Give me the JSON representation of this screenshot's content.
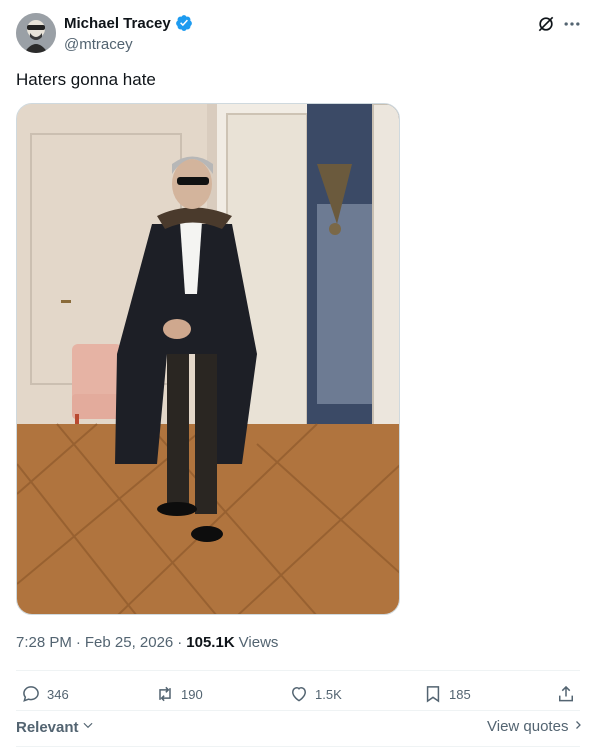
{
  "author": {
    "display_name": "Michael Tracey",
    "handle": "@mtracey",
    "verified_icon": "verified-badge-icon",
    "avatar_icon": "avatar-image"
  },
  "header_actions": {
    "grok_icon": "grok-icon",
    "more_icon": "more-options-icon"
  },
  "tweet": {
    "text": "Haters gonna hate",
    "media_description": "photo"
  },
  "meta": {
    "time": "7:28 PM",
    "separator": "·",
    "date": "Feb 25, 2026",
    "separator2": "·",
    "views_count": "105.1K",
    "views_label": "Views"
  },
  "actions": {
    "replies": "346",
    "reposts": "190",
    "likes": "1.5K",
    "bookmarks": "185"
  },
  "footer": {
    "sort_label": "Relevant",
    "view_quotes_label": "View quotes"
  },
  "colors": {
    "text": "#0f1419",
    "secondary": "#536471",
    "verified": "#1d9bf0",
    "divider": "#eff3f4"
  }
}
